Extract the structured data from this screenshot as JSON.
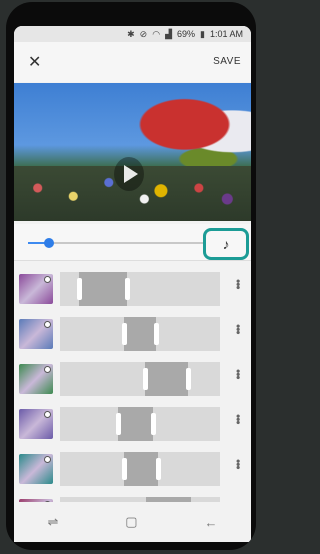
{
  "status_bar": {
    "icons": [
      "bluetooth-icon",
      "mute-icon",
      "wifi-icon",
      "signal-icon"
    ],
    "battery": "69%",
    "battery_icon": "battery-icon",
    "time": "1:01 AM"
  },
  "app_bar": {
    "close_icon": "close-icon",
    "save_label": "SAVE"
  },
  "video": {
    "play_icon": "play-icon",
    "playback_progress": 0.12
  },
  "music_button": {
    "icon": "music-note-icon",
    "highlight_color": "#1c9c96"
  },
  "clips": [
    {
      "thumb_color": "#8a4a9a",
      "selection_start": 0.12,
      "selection_end": 0.42
    },
    {
      "thumb_color": "#5a7ab8",
      "selection_start": 0.4,
      "selection_end": 0.6
    },
    {
      "thumb_color": "#3d8a50",
      "selection_start": 0.53,
      "selection_end": 0.8
    },
    {
      "thumb_color": "#6a5aa8",
      "selection_start": 0.36,
      "selection_end": 0.58
    },
    {
      "thumb_color": "#2a8a8a",
      "selection_start": 0.4,
      "selection_end": 0.61
    },
    {
      "thumb_color": "#9a3a6a",
      "selection_start": 0.54,
      "selection_end": 0.82
    }
  ],
  "nav_bar": {
    "recents_icon": "recents-icon",
    "home_icon": "home-icon",
    "back_icon": "back-icon"
  }
}
